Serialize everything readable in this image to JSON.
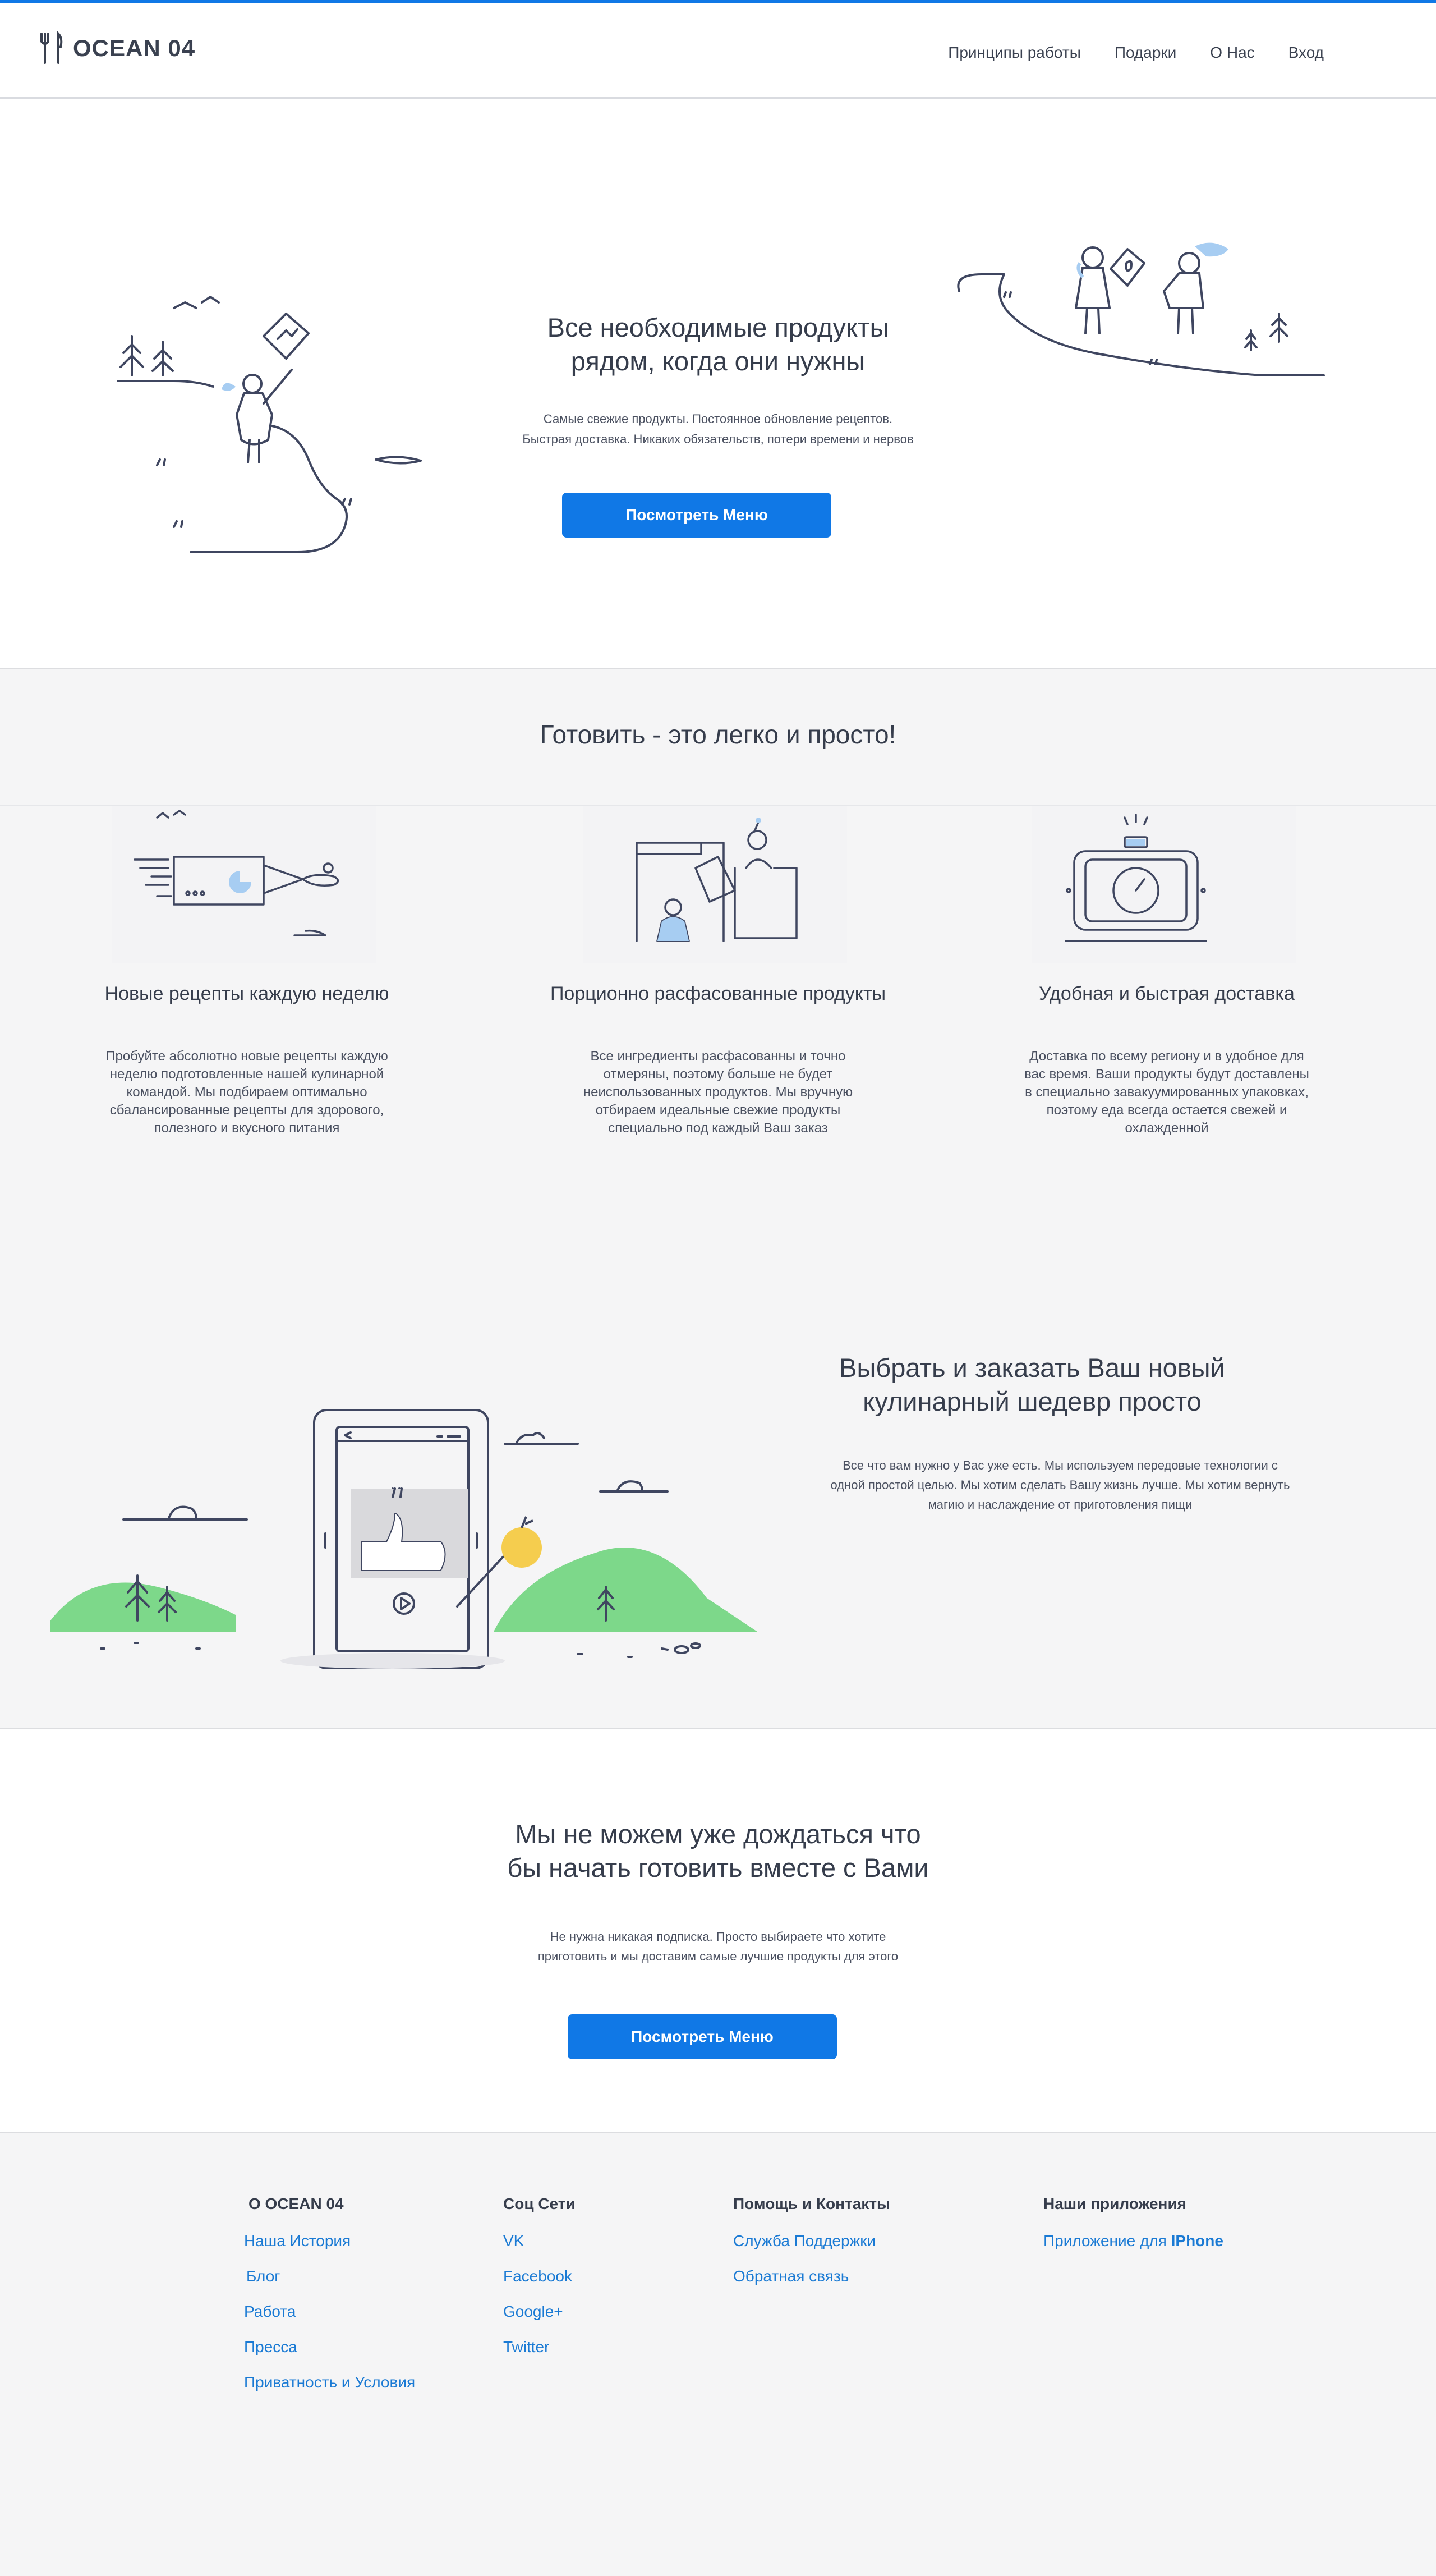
{
  "header": {
    "logo_text": "OCEAN 04",
    "nav": [
      "Принципы работы",
      "Подарки",
      "О Нас",
      "Вход"
    ]
  },
  "hero": {
    "title_line1": "Все необходимые продукты",
    "title_line2": "рядом, когда они нужны",
    "sub_line1": "Самые свежие продукты. Постоянное обновление рецептов.",
    "sub_line2": "Быстрая доставка. Никаких обязательств, потери времени и нервов",
    "button": "Посмотреть Меню"
  },
  "how": {
    "title": "Готовить - это легко и просто!",
    "features": [
      {
        "title": "Новые рецепты каждую неделю",
        "desc": "Пробуйте абсолютно новые рецепты каждую неделю подготовленные нашей кулинарной командой. Мы подбираем оптимально сбалансированные рецепты для здорового, полезного и вкусного питания"
      },
      {
        "title": "Порционно расфасованные продукты",
        "desc": "Все ингредиенты расфасованны и точно отмеряны, поэтому больше не будет неиспользованных продуктов. Мы вручную отбираем идеальные свежие продукты специально под каждый Ваш заказ"
      },
      {
        "title": "Удобная и быстрая доставка",
        "desc": "Доставка по всему региону и в удобное для вас время. Ваши продукты будут доставлены в специально завакуумированных упаковках, поэтому еда всегда остается свежей и охлажденной"
      }
    ]
  },
  "choose": {
    "title_line1": "Выбрать и заказать Ваш новый",
    "title_line2": "кулинарный шедевр просто",
    "desc": "Все что вам нужно у Вас уже есть. Мы используем передовые технологии с одной простой целью. Мы хотим сделать Вашу жизнь лучше. Мы хотим вернуть магию и наслаждение от приготовления пищи"
  },
  "cta": {
    "title_line1": "Мы не можем уже дождаться что",
    "title_line2": "бы начать готовить вместе с Вами",
    "sub_line1": "Не нужна никакая подписка. Просто выбираете что хотите",
    "sub_line2": "приготовить и мы доставим самые лучшие продукты для этого",
    "button": "Посмотреть Меню"
  },
  "footer": {
    "col1": {
      "heading": "О OCEAN 04",
      "links": [
        "Наша История",
        "Блог",
        "Работа",
        "Пресса",
        "Приватность и Условия"
      ]
    },
    "col2": {
      "heading": "Соц Сети",
      "links": [
        "VK",
        "Facebook",
        "Google+",
        "Twitter"
      ]
    },
    "col3": {
      "heading": "Помощь и Контакты",
      "links": [
        "Служба Поддержки",
        "Обратная связь"
      ]
    },
    "col4": {
      "heading": "Наши приложения",
      "link_prefix": "Приложение для ",
      "link_strong": "IPhone"
    }
  },
  "colors": {
    "accent": "#1078e6",
    "link": "#1a7ad4",
    "hill": "#7dd88a",
    "illustration_blue": "#a7cdf2"
  }
}
